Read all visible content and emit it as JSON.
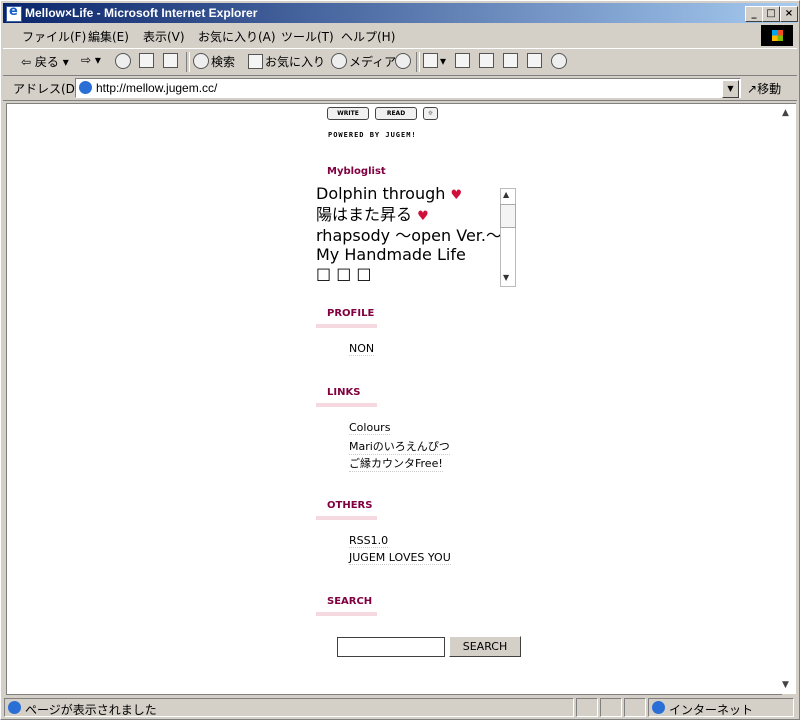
{
  "window": {
    "title": "Mellow×Life - Microsoft Internet Explorer"
  },
  "menu": [
    "ファイル(F)",
    "編集(E)",
    "表示(V)",
    "お気に入り(A)",
    "ツール(T)",
    "ヘルプ(H)"
  ],
  "toolbar": {
    "back": "戻る",
    "search": "検索",
    "favorites": "お気に入り",
    "media": "メディア"
  },
  "address": {
    "label": "アドレス(D)",
    "url": "http://mellow.jugem.cc/",
    "go": "移動"
  },
  "page": {
    "write_btn": "WRITE",
    "read_btn": "READ",
    "powered": "POWERED BY JUGEM!",
    "mybloglist": {
      "heading": "Mybloglist",
      "items": [
        "Dolphin through",
        "陽はまた昇る",
        "rhapsody ～open Ver.～",
        "My Handmade Life",
        "□ □ □"
      ]
    },
    "profile": {
      "heading": "PROFILE",
      "items": [
        "NON"
      ]
    },
    "links": {
      "heading": "LINKS",
      "items": [
        "Colours",
        "Mariのいろえんぴつ",
        "ご縁カウンタFree!"
      ]
    },
    "others": {
      "heading": "OTHERS",
      "items": [
        "RSS1.0",
        "JUGEM LOVES YOU"
      ]
    },
    "search": {
      "heading": "SEARCH",
      "button": "SEARCH",
      "value": ""
    }
  },
  "status": {
    "text": "ページが表示されました",
    "zone": "インターネット"
  }
}
